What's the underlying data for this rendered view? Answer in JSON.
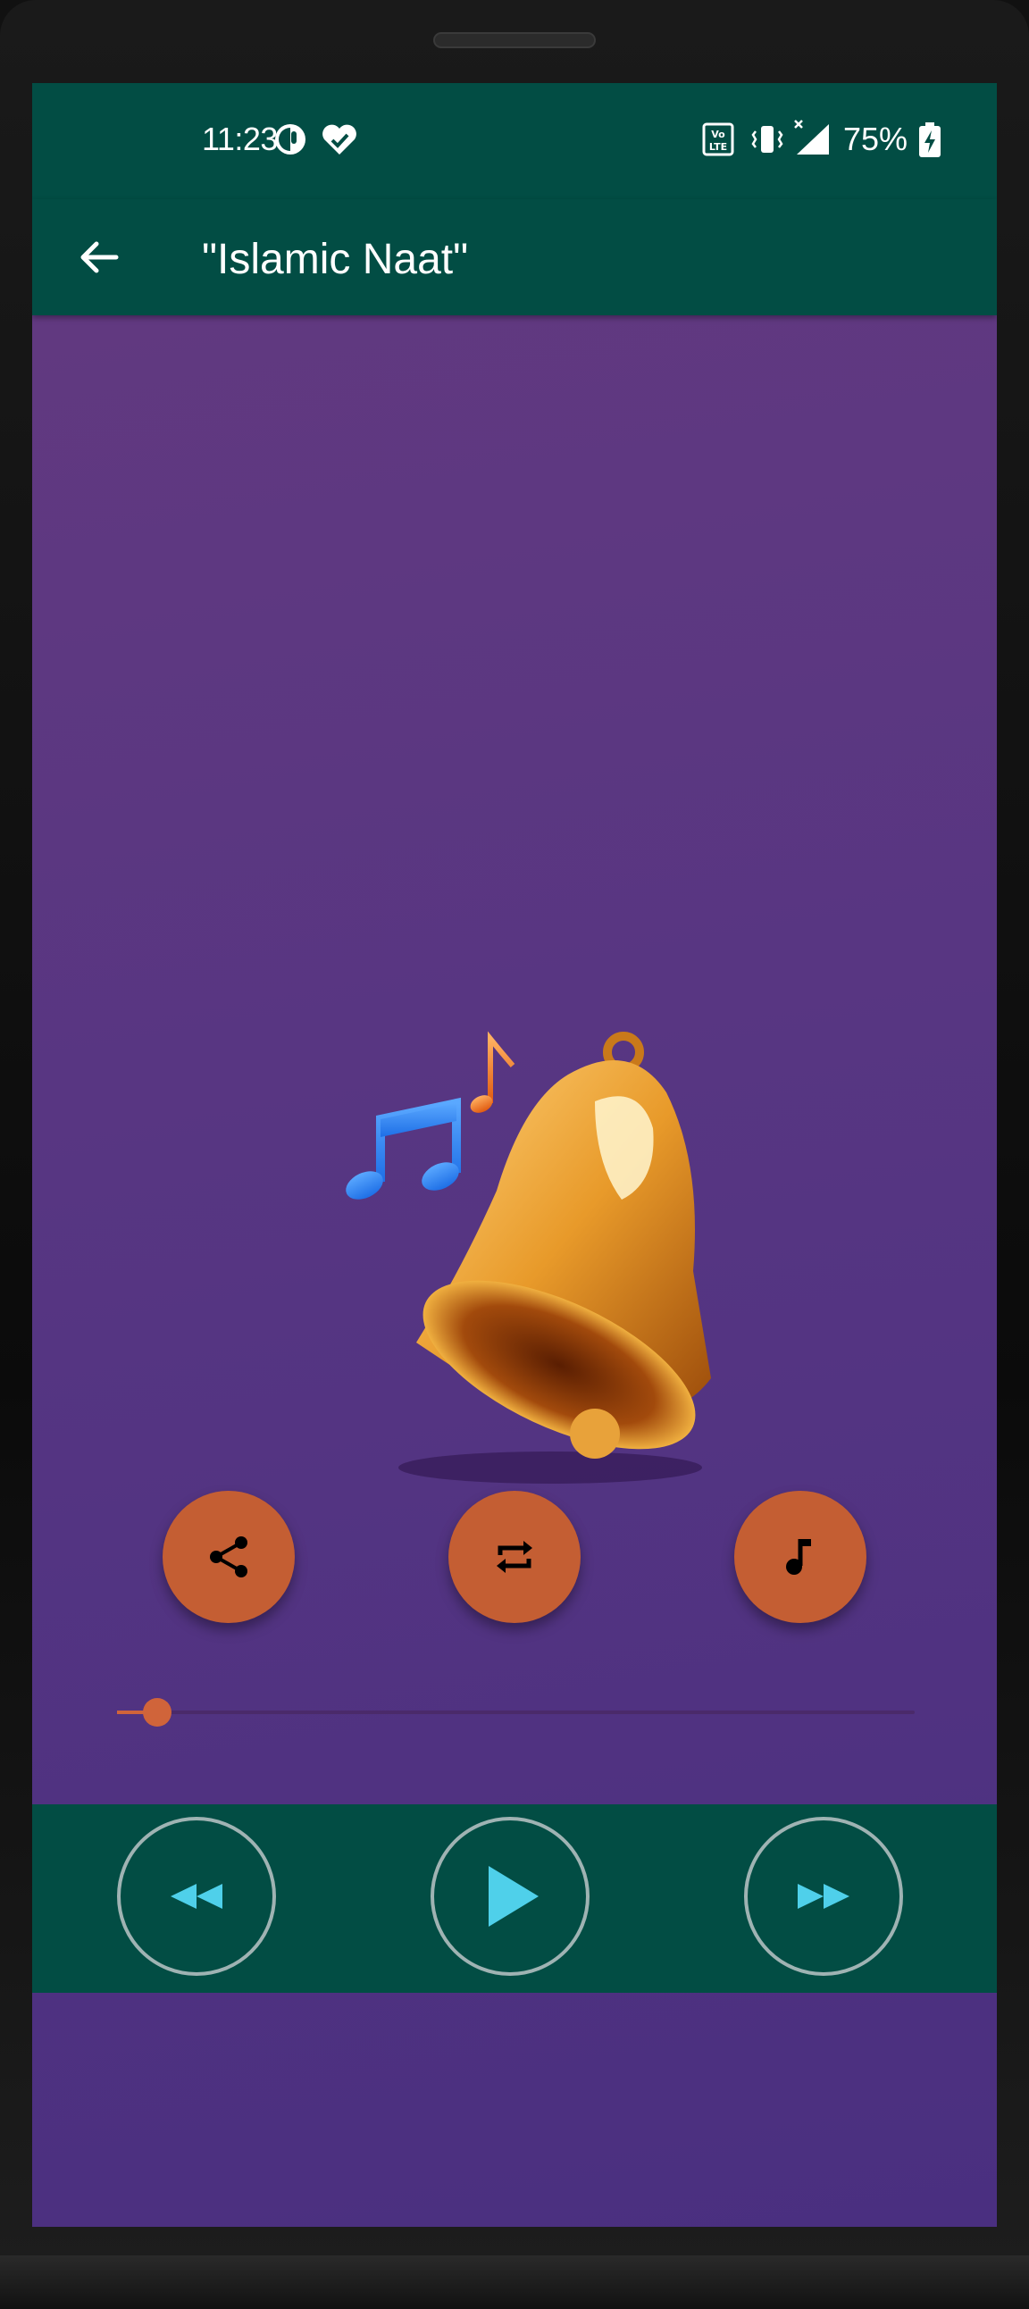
{
  "status_bar": {
    "time": "11:23",
    "battery_percent": "75%",
    "icons": [
      "data-saver-icon",
      "health-check-icon",
      "volte-icon",
      "vibrate-icon",
      "signal-icon",
      "battery-charging-icon"
    ]
  },
  "app_bar": {
    "title": "\"Islamic Naat\"",
    "back_icon": "arrow-back-icon"
  },
  "artwork": {
    "icon": "bell-with-music-notes"
  },
  "actions": [
    {
      "name": "share",
      "icon": "share-icon"
    },
    {
      "name": "repeat",
      "icon": "repeat-icon"
    },
    {
      "name": "set-ringtone",
      "icon": "music-note-icon"
    }
  ],
  "seekbar": {
    "progress": 0.05
  },
  "player_controls": [
    {
      "name": "rewind",
      "icon": "rewind-icon"
    },
    {
      "name": "play",
      "icon": "play-icon"
    },
    {
      "name": "fast-forward",
      "icon": "fast-forward-icon"
    }
  ],
  "colors": {
    "bar_background": "#024d44",
    "page_background": "#553582",
    "accent": "#c45e33",
    "player_icon": "#4fd0ea"
  }
}
